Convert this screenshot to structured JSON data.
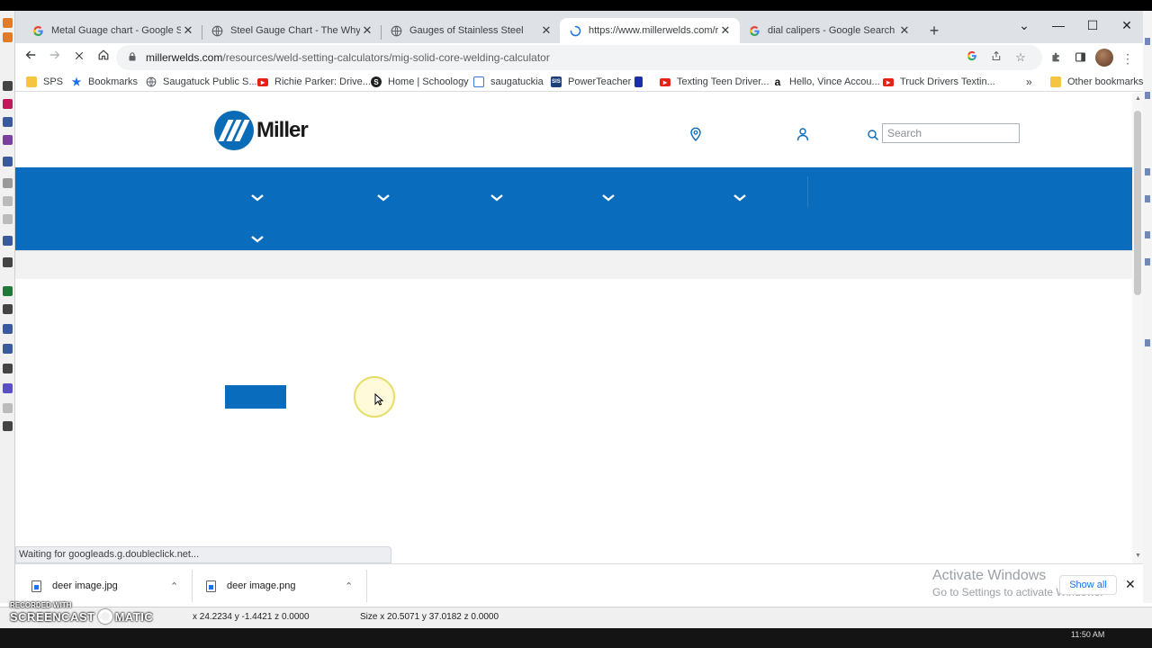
{
  "tabs": [
    {
      "title": "Metal Guage chart - Google Search",
      "favicon": "google-icon",
      "active": false
    },
    {
      "title": "Steel Gauge Chart - The Why and",
      "favicon": "globe-icon",
      "active": false
    },
    {
      "title": "Gauges of Stainless Steel",
      "favicon": "globe-icon",
      "active": false
    },
    {
      "title": "https://www.millerwelds.com/resources",
      "favicon": "loading-spinner-icon",
      "active": true
    },
    {
      "title": "dial calipers - Google Search",
      "favicon": "google-icon",
      "active": false
    }
  ],
  "address_bar": {
    "domain": "millerwelds.com",
    "path": "/resources/weld-setting-calculators/mig-solid-core-welding-calculator"
  },
  "bookmarks": [
    {
      "label": "SPS",
      "icon": "folder-icon",
      "color": "#f5c542"
    },
    {
      "label": "Bookmarks",
      "icon": "star-icon",
      "color": "#1a73e8"
    },
    {
      "label": "Saugatuck Public S...",
      "icon": "globe-icon",
      "color": "#5f6368"
    },
    {
      "label": "Richie Parker: Drive...",
      "icon": "youtube-icon",
      "color": "#e62117"
    },
    {
      "label": "Home | Schoology",
      "icon": "schoology-icon",
      "color": "#202124"
    },
    {
      "label": "saugatuckia",
      "icon": "grid-icon",
      "color": "#3a7ad9"
    },
    {
      "label": "PowerTeacher",
      "icon": "sis-icon",
      "color": "#1c3f7a"
    },
    {
      "label": "",
      "icon": "blue-bookmark-icon",
      "color": "#1c2fa8"
    },
    {
      "label": "Texting Teen Driver...",
      "icon": "youtube-icon",
      "color": "#e62117"
    },
    {
      "label": "Hello, Vince Accou...",
      "icon": "amazon-icon",
      "color": "#111111"
    },
    {
      "label": "Truck Drivers Textin...",
      "icon": "youtube-icon",
      "color": "#e62117"
    },
    {
      "label": "Other bookmarks",
      "icon": "folder-icon",
      "color": "#f5c542"
    }
  ],
  "site": {
    "brand": "Miller",
    "brand_color": "#0a6cbc",
    "search_placeholder": "Search"
  },
  "status_text": "Waiting for googleads.g.doubleclick.net...",
  "downloads": [
    {
      "name": "deer image.jpg"
    },
    {
      "name": "deer image.png"
    }
  ],
  "shelf": {
    "show_all": "Show all",
    "activate_title": "Activate Windows",
    "activate_sub": "Go to Settings to activate Windows."
  },
  "coords": {
    "position": "x 24.2234 y -1.4421 z 0.0000",
    "size": "Size x 20.5071 y 37.0182 z 0.0000"
  },
  "watermark": {
    "recorded": "RECORDED WITH",
    "brand_left": "SCREENCAST",
    "brand_right": "MATIC"
  },
  "tray_time": "11:50 AM"
}
